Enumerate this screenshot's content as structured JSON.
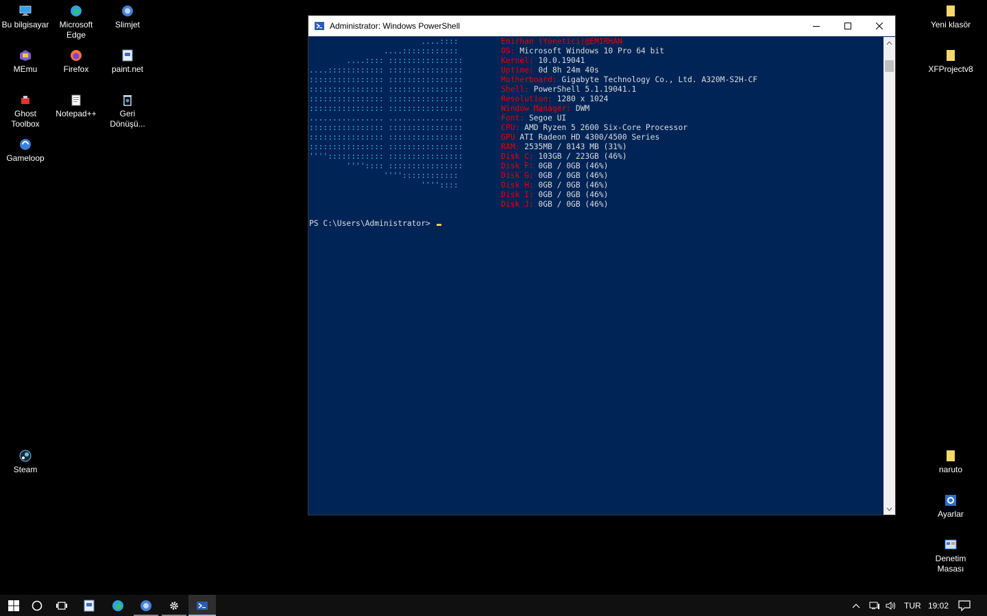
{
  "desktop": {
    "icons_left": [
      {
        "label": "Bu bilgisayar",
        "icon": "computer-icon"
      },
      {
        "label": "Microsoft Edge",
        "icon": "edge-icon"
      },
      {
        "label": "Slimjet",
        "icon": "slimjet-icon"
      },
      {
        "label": "MEmu",
        "icon": "memu-icon"
      },
      {
        "label": "Firefox",
        "icon": "firefox-icon"
      },
      {
        "label": "paint.net",
        "icon": "paintnet-icon"
      },
      {
        "label": "Ghost Toolbox",
        "icon": "ghost-toolbox-icon"
      },
      {
        "label": "Notepad++",
        "icon": "notepadpp-icon"
      },
      {
        "label": "Geri Dönüşü...",
        "icon": "recycle-bin-icon"
      },
      {
        "label": "Gameloop",
        "icon": "gameloop-icon"
      },
      {
        "label": "Steam",
        "icon": "steam-icon"
      }
    ],
    "icons_right": [
      {
        "label": "Yeni klasör",
        "icon": "folder-icon"
      },
      {
        "label": "XFProjectv8",
        "icon": "folder-icon"
      },
      {
        "label": "naruto",
        "icon": "folder-icon"
      },
      {
        "label": "Ayarlar",
        "icon": "settings-icon"
      },
      {
        "label": "Denetim Masası",
        "icon": "control-panel-icon"
      }
    ]
  },
  "window": {
    "title": "Administrator: Windows PowerShell",
    "art_lines": [
      "                        ....::::",
      "                ....::::::::::::",
      "        ....:::: ::::::::::::::::",
      "....:::::::::::: ::::::::::::::::",
      ":::::::::::::::: ::::::::::::::::",
      ":::::::::::::::: ::::::::::::::::",
      ":::::::::::::::: ::::::::::::::::",
      ":::::::::::::::: ::::::::::::::::",
      "................ ................",
      ":::::::::::::::: ::::::::::::::::",
      ":::::::::::::::: ::::::::::::::::",
      ":::::::::::::::: ::::::::::::::::",
      "'''':::::::::::: ::::::::::::::::",
      "        '''':::: ::::::::::::::::",
      "                ''''::::::::::::",
      "                        ''''::::"
    ],
    "user_host": "Emirhan (Yönetici)@EMIRHAN",
    "info": [
      {
        "key": "OS:",
        "value": " Microsoft Windows 10 Pro 64 bit"
      },
      {
        "key": "Kernel:",
        "value": " 10.0.19041"
      },
      {
        "key": "Uptime:",
        "value": " 0d 8h 24m 40s"
      },
      {
        "key": "Motherboard:",
        "value": " Gigabyte Technology Co., Ltd. A320M-S2H-CF"
      },
      {
        "key": "Shell:",
        "value": " PowerShell 5.1.19041.1"
      },
      {
        "key": "Resolution:",
        "value": " 1280 x 1024"
      },
      {
        "key": "Window Manager:",
        "value": " DWM"
      },
      {
        "key": "Font:",
        "value": " Segoe UI"
      },
      {
        "key": "CPU:",
        "value": " AMD Ryzen 5 2600 Six-Core Processor"
      },
      {
        "key": "GPU",
        "value": " ATI Radeon HD 4300/4500 Series"
      },
      {
        "key": "RAM:",
        "value": " 2535MB / 8143 MB (31%)"
      },
      {
        "key": "Disk C:",
        "value": " 103GB / 223GB (46%)"
      },
      {
        "key": "Disk F:",
        "value": " 0GB / 0GB (46%)"
      },
      {
        "key": "Disk G:",
        "value": " 0GB / 0GB (46%)"
      },
      {
        "key": "Disk H:",
        "value": " 0GB / 0GB (46%)"
      },
      {
        "key": "Disk I:",
        "value": " 0GB / 0GB (46%)"
      },
      {
        "key": "Disk J:",
        "value": " 0GB / 0GB (46%)"
      }
    ],
    "prompt": "PS C:\\Users\\Administrator> "
  },
  "taskbar": {
    "apps": [
      {
        "name": "start-button",
        "icon": "windows-logo-icon"
      },
      {
        "name": "search-button",
        "icon": "cortana-circle-icon"
      },
      {
        "name": "task-view-button",
        "icon": "task-view-icon"
      },
      {
        "name": "paintnet-taskbar",
        "icon": "paintnet-icon"
      },
      {
        "name": "edge-taskbar",
        "icon": "edge-icon"
      },
      {
        "name": "slimjet-taskbar",
        "icon": "slimjet-icon"
      },
      {
        "name": "settings-taskbar",
        "icon": "gear-icon"
      },
      {
        "name": "powershell-taskbar",
        "icon": "powershell-icon"
      }
    ],
    "language": "TUR",
    "time": "19:02"
  },
  "colors": {
    "console_bg": "#012456",
    "art": "#3bb8d9",
    "key": "#ee0000"
  }
}
